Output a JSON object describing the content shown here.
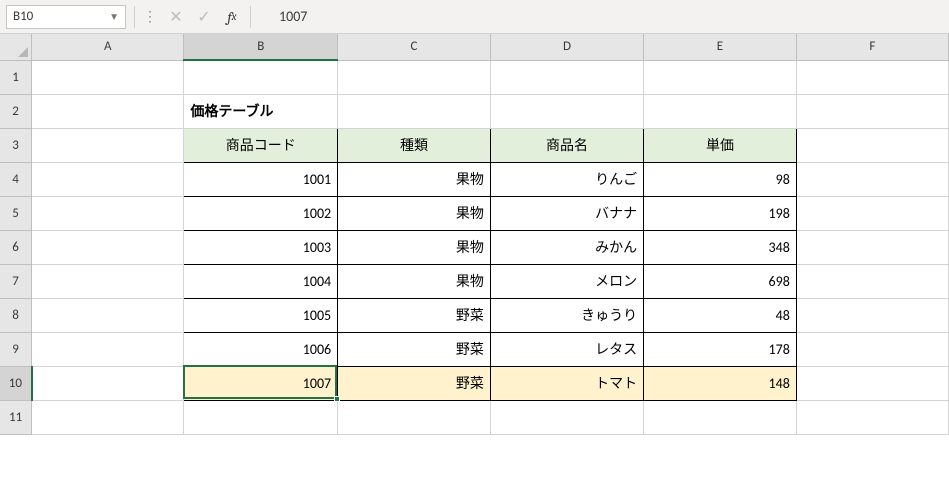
{
  "nameBox": "B10",
  "formulaValue": "1007",
  "columns": [
    "A",
    "B",
    "C",
    "D",
    "E",
    "F"
  ],
  "rowCount": 11,
  "activeCell": {
    "col": "B",
    "row": 10
  },
  "colWidths": {
    "A": 155,
    "B": 155,
    "C": 155,
    "D": 155,
    "E": 155,
    "F": 155
  },
  "cells": {
    "B2": {
      "v": "価格テーブル",
      "cls": "bold"
    },
    "B3": {
      "v": "商品コード",
      "cls": "header-green center"
    },
    "C3": {
      "v": "種類",
      "cls": "header-green center"
    },
    "D3": {
      "v": "商品名",
      "cls": "header-green center"
    },
    "E3": {
      "v": "単価",
      "cls": "header-green center"
    },
    "B4": {
      "v": "1001",
      "cls": "tbl-border ralign"
    },
    "C4": {
      "v": "果物",
      "cls": "tbl-border ralign"
    },
    "D4": {
      "v": "りんご",
      "cls": "tbl-border ralign"
    },
    "E4": {
      "v": "98",
      "cls": "tbl-border ralign"
    },
    "B5": {
      "v": "1002",
      "cls": "tbl-border ralign"
    },
    "C5": {
      "v": "果物",
      "cls": "tbl-border ralign"
    },
    "D5": {
      "v": "バナナ",
      "cls": "tbl-border ralign"
    },
    "E5": {
      "v": "198",
      "cls": "tbl-border ralign"
    },
    "B6": {
      "v": "1003",
      "cls": "tbl-border ralign"
    },
    "C6": {
      "v": "果物",
      "cls": "tbl-border ralign"
    },
    "D6": {
      "v": "みかん",
      "cls": "tbl-border ralign"
    },
    "E6": {
      "v": "348",
      "cls": "tbl-border ralign"
    },
    "B7": {
      "v": "1004",
      "cls": "tbl-border ralign"
    },
    "C7": {
      "v": "果物",
      "cls": "tbl-border ralign"
    },
    "D7": {
      "v": "メロン",
      "cls": "tbl-border ralign"
    },
    "E7": {
      "v": "698",
      "cls": "tbl-border ralign"
    },
    "B8": {
      "v": "1005",
      "cls": "tbl-border ralign"
    },
    "C8": {
      "v": "野菜",
      "cls": "tbl-border ralign"
    },
    "D8": {
      "v": "きゅうり",
      "cls": "tbl-border ralign"
    },
    "E8": {
      "v": "48",
      "cls": "tbl-border ralign"
    },
    "B9": {
      "v": "1006",
      "cls": "tbl-border ralign"
    },
    "C9": {
      "v": "野菜",
      "cls": "tbl-border ralign"
    },
    "D9": {
      "v": "レタス",
      "cls": "tbl-border ralign"
    },
    "E9": {
      "v": "178",
      "cls": "tbl-border ralign"
    },
    "B10": {
      "v": "1007",
      "cls": "tbl-border ralign hl-yellow"
    },
    "C10": {
      "v": "野菜",
      "cls": "tbl-border ralign hl-yellow"
    },
    "D10": {
      "v": "トマト",
      "cls": "tbl-border ralign hl-yellow"
    },
    "E10": {
      "v": "148",
      "cls": "tbl-border ralign hl-yellow"
    }
  },
  "chart_data": {
    "type": "table",
    "title": "価格テーブル",
    "columns": [
      "商品コード",
      "種類",
      "商品名",
      "単価"
    ],
    "rows": [
      [
        1001,
        "果物",
        "りんご",
        98
      ],
      [
        1002,
        "果物",
        "バナナ",
        198
      ],
      [
        1003,
        "果物",
        "みかん",
        348
      ],
      [
        1004,
        "果物",
        "メロン",
        698
      ],
      [
        1005,
        "野菜",
        "きゅうり",
        48
      ],
      [
        1006,
        "野菜",
        "レタス",
        178
      ],
      [
        1007,
        "野菜",
        "トマト",
        148
      ]
    ]
  }
}
